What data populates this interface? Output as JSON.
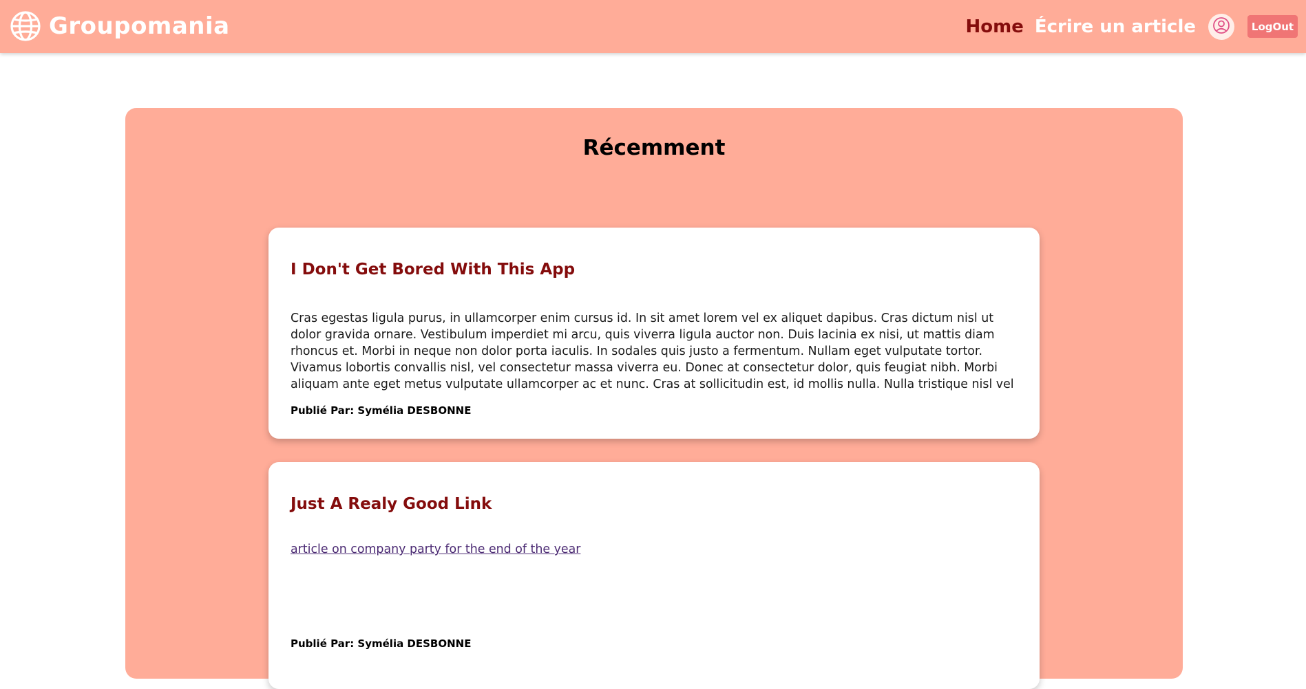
{
  "header": {
    "brand_name": "Groupomania",
    "brand_icon": "globe-icon",
    "nav": {
      "home_label": "Home",
      "write_label": "Écrire un article"
    },
    "profile_icon": "user-circle-icon",
    "logout_label": "LogOut"
  },
  "main": {
    "section_title": "Récemment",
    "posts": [
      {
        "title": "I Don't Get Bored With This App",
        "body": "Cras egestas ligula purus, in ullamcorper enim cursus id. In sit amet lorem vel ex aliquet dapibus. Cras dictum nisl ut dolor gravida ornare. Vestibulum imperdiet mi arcu, quis viverra ligula auctor non. Duis lacinia ex nisi, ut mattis diam rhoncus et. Morbi in neque non dolor porta iaculis. In sodales quis justo a fermentum. Nullam eget vulputate tortor. Vivamus lobortis convallis nisl, vel consectetur massa viverra eu. Donec at consectetur dolor, quis feugiat nibh. Morbi aliquam ante eget metus vulputate ullamcorper ac et nunc. Cras at sollicitudin est, id mollis nulla. Nulla tristique nisl vel",
        "author": "Publié Par: Symélia DESBONNE"
      },
      {
        "title": "Just A Realy Good Link",
        "link_text": "article on company party for the end of the year",
        "author": "Publié Par: Symélia DESBONNE"
      }
    ]
  },
  "colors": {
    "primary": "#ffac98",
    "accent_dark_red": "#840c0c",
    "logout_button": "#f07575",
    "link": "#4b2a73"
  }
}
